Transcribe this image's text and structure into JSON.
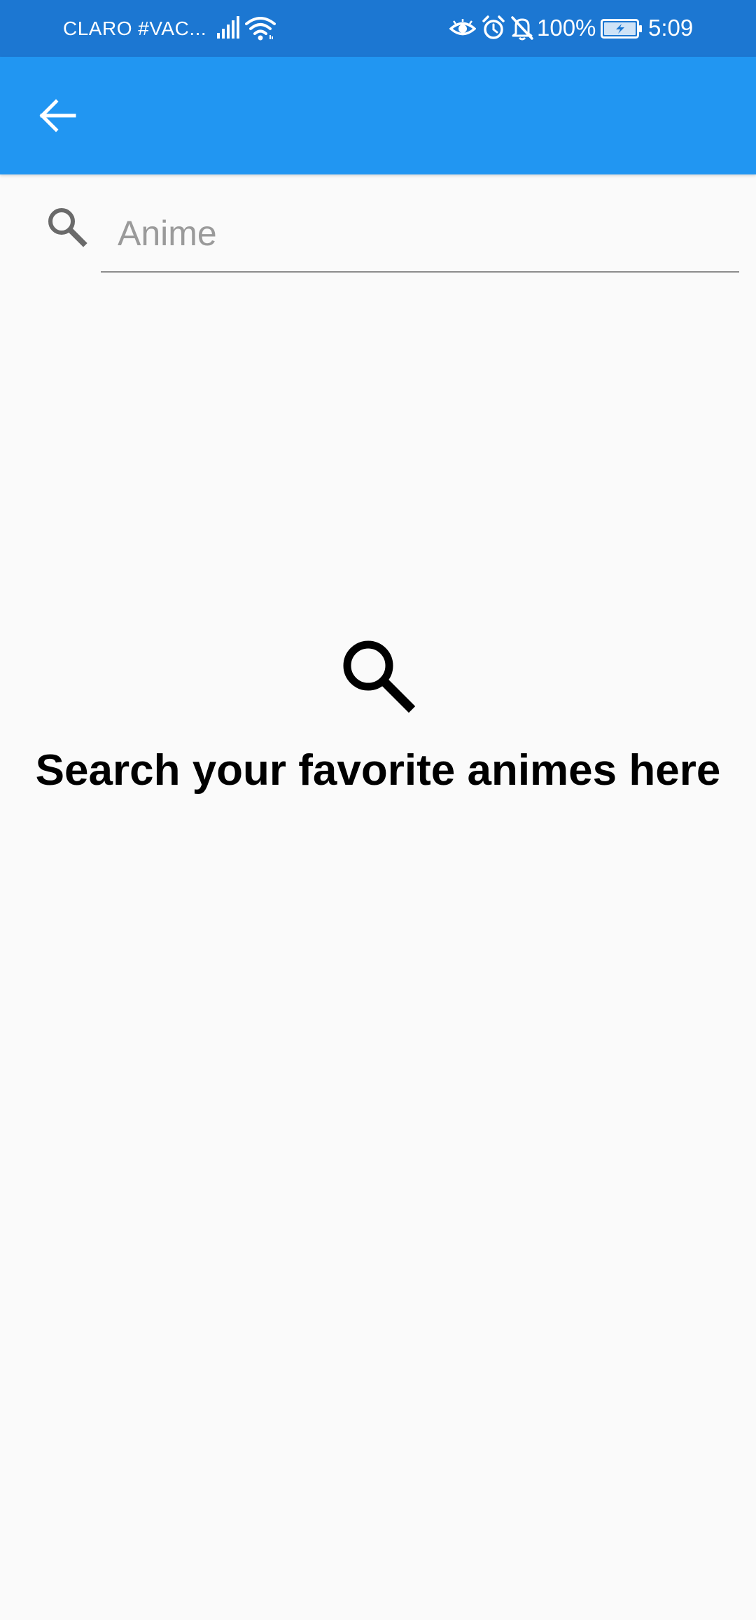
{
  "status_bar": {
    "carrier": "CLARO #VAC...",
    "battery_percent": "100%",
    "time": "5:09",
    "icons": [
      "signal-icon",
      "wifi-icon",
      "eye-icon",
      "alarm-icon",
      "mute-icon",
      "battery-icon"
    ],
    "background": "#1c77d2"
  },
  "app_bar": {
    "back_icon": "arrow-back-icon",
    "background": "#2196f2"
  },
  "search": {
    "placeholder": "Anime",
    "value": "",
    "icon": "search-icon"
  },
  "empty_state": {
    "icon": "search-icon",
    "message": "Search your favorite animes here"
  }
}
